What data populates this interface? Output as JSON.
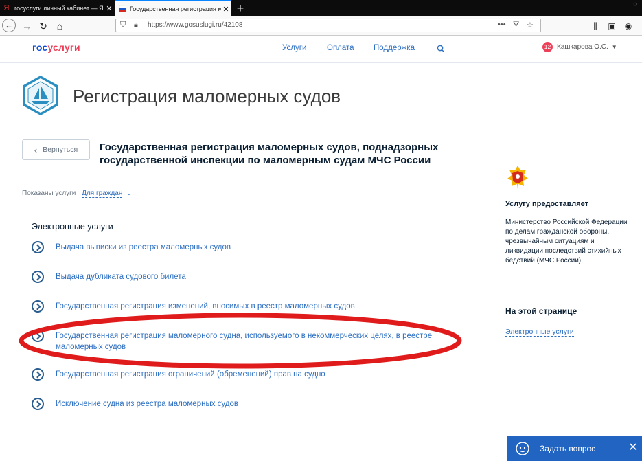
{
  "browser": {
    "tabs": [
      {
        "title": "госуслуги личный кабинет — Ян"
      },
      {
        "title": "Государственная регистрация м"
      }
    ],
    "url": "https://www.gosuslugi.ru/42108"
  },
  "site": {
    "logo_part1": "гос",
    "logo_part2": "услуги",
    "menu": [
      "Услуги",
      "Оплата",
      "Поддержка"
    ],
    "user_badge": "12",
    "user_name": "Кашкарова О.С."
  },
  "page": {
    "title": "Регистрация маломерных судов",
    "back_label": "Вернуться",
    "service_title": "Государственная регистрация маломерных судов, поднадзорных государственной инспекции по маломерным судам МЧС России",
    "filter_label": "Показаны услуги",
    "filter_value": "Для граждан",
    "section_heading": "Электронные услуги",
    "services": [
      {
        "label": "Выдача выписки из реестра маломерных судов"
      },
      {
        "label": "Выдача дубликата судового билета"
      },
      {
        "label": "Государственная регистрация изменений, вносимых в реестр маломерных судов"
      },
      {
        "label": "Государственная регистрация маломерного судна, используемого в некоммерческих целях, в реестре маломерных судов"
      },
      {
        "label": "Государственная регистрация ограничений (обременений) прав на судно"
      },
      {
        "label": "Исключение судна из реестра маломерных судов"
      }
    ]
  },
  "sidebar": {
    "provider_heading": "Услугу предоставляет",
    "provider_text": "Министерство Российской Федерации по делам гражданской обороны, чрезвычайным ситуациям и ликвидации последствий стихийных бедствий (МЧС России)",
    "onpage_heading": "На этой странице",
    "onpage_link": "Электронные услуги"
  },
  "ask_button": "Задать вопрос",
  "colors": {
    "accent": "#2d6fc2",
    "brand_red": "#ee3f58",
    "annotation": "#e01b1b"
  }
}
